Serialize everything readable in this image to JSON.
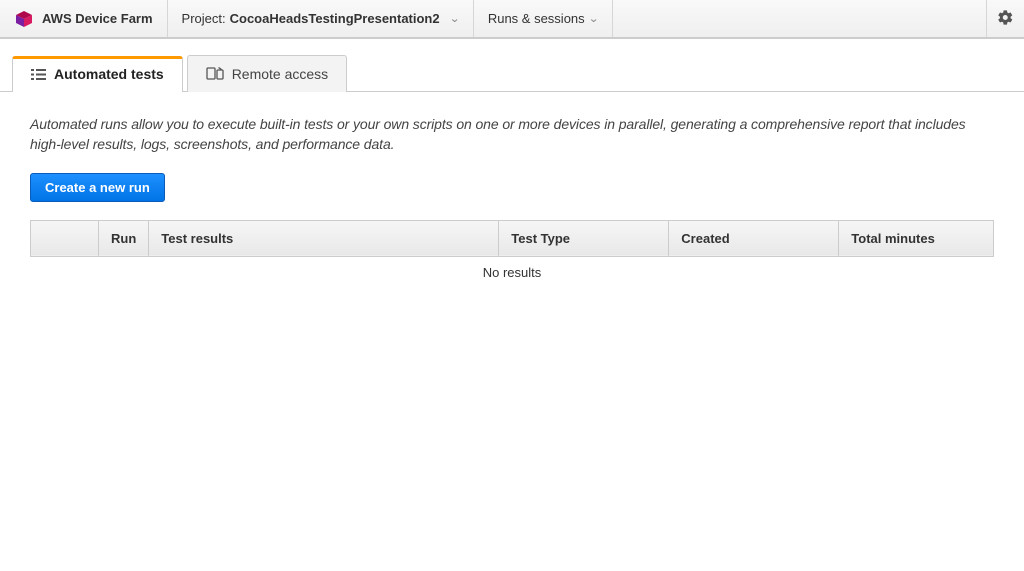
{
  "topbar": {
    "service_title": "AWS Device Farm",
    "project_label": "Project:",
    "project_value": "CocoaHeadsTestingPresentation2",
    "runs_sessions_label": "Runs & sessions"
  },
  "tabs": {
    "automated_tests": "Automated tests",
    "remote_access": "Remote access"
  },
  "panel": {
    "intro_text": "Automated runs allow you to execute built-in tests or your own scripts on one or more devices in parallel, generating a comprehensive report that includes high-level results, logs, screenshots, and performance data.",
    "create_run_label": "Create a new run",
    "columns": {
      "run": "Run",
      "test_results": "Test results",
      "test_type": "Test Type",
      "created": "Created",
      "total_minutes": "Total minutes"
    },
    "empty_message": "No results"
  }
}
